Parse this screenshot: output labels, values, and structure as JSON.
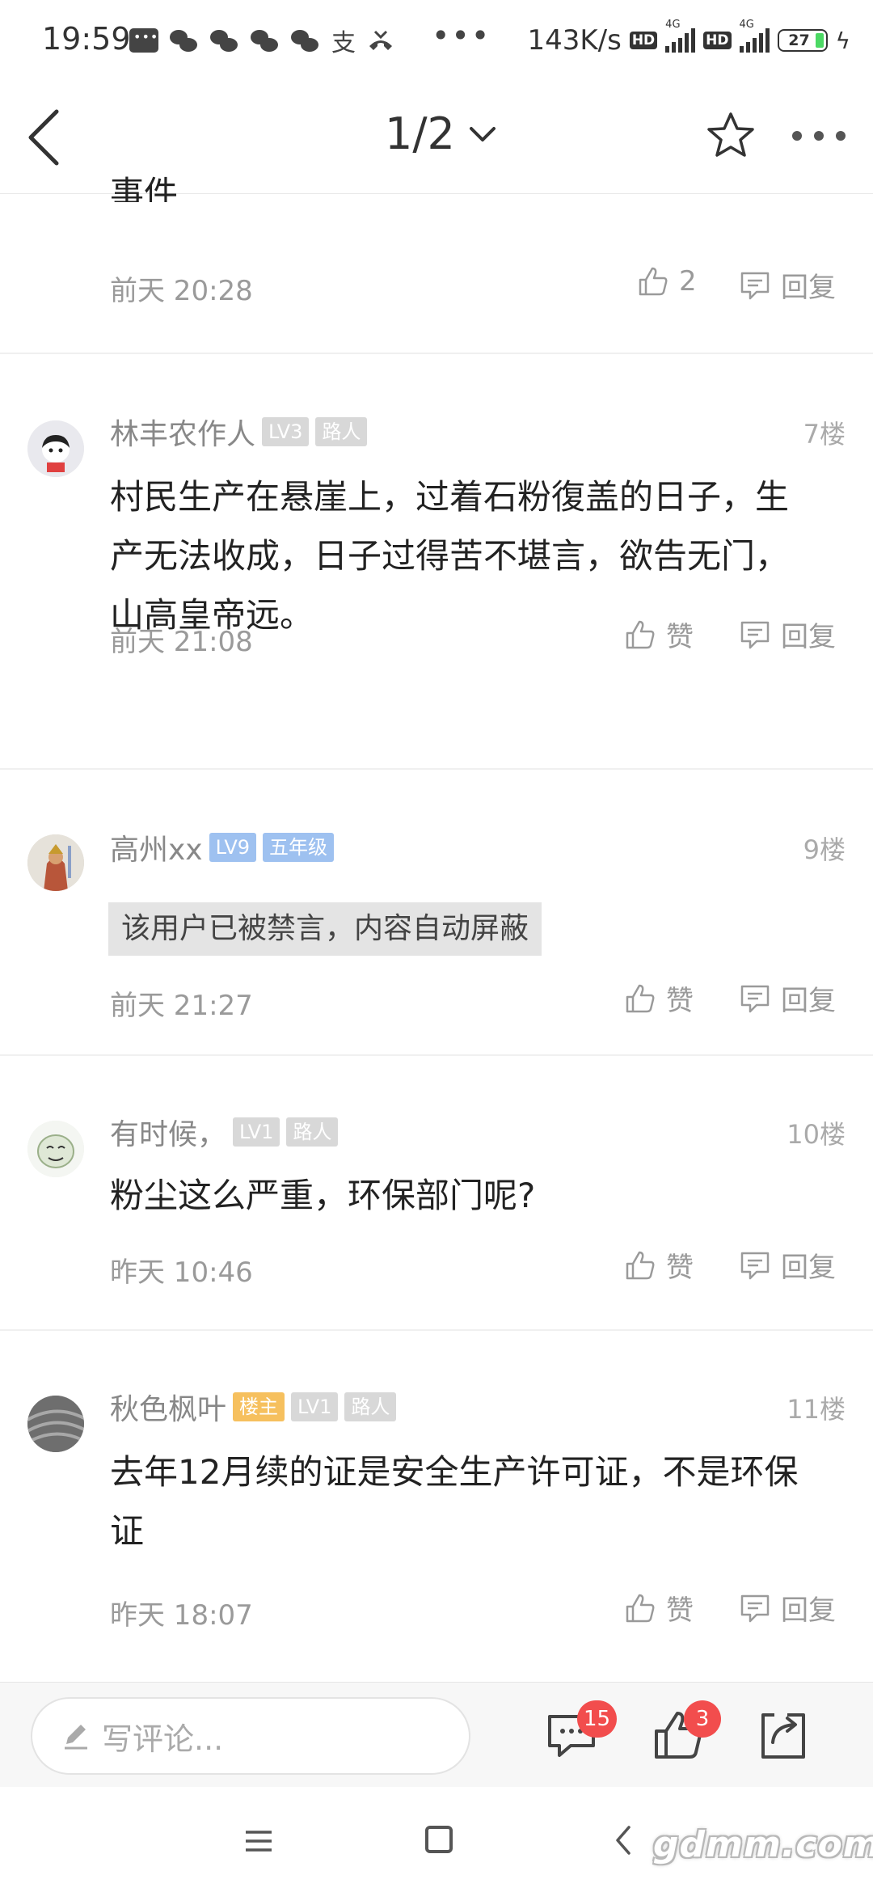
{
  "status_bar": {
    "time": "19:59",
    "speed": "143K/s",
    "hd": "HD",
    "network": "4G",
    "battery": "27",
    "dots": "•••",
    "alipay_glyph": "支",
    "bell_glyph": "⚡"
  },
  "nav": {
    "pager": "1/2"
  },
  "partial_comment": {
    "clipped_text": "事件",
    "time": "前天 20:28",
    "like_count": "2",
    "reply_label": "回复"
  },
  "comments": [
    {
      "username": "林丰农作人",
      "tags": [
        "LV3",
        "路人"
      ],
      "floor": "7楼",
      "text": "村民生产在悬崖上，过着石粉復盖的日子，生产无法收成，日子过得苦不堪言，欲告无门，山高皇帝远。",
      "time": "前天 21:08",
      "like_label": "赞",
      "reply_label": "回复"
    },
    {
      "username": "高州xx",
      "tags": [
        "LV9",
        "五年级"
      ],
      "floor": "9楼",
      "text": "该用户已被禁言，内容自动屏蔽",
      "time": "前天 21:27",
      "like_label": "赞",
      "reply_label": "回复"
    },
    {
      "username": "有时候，",
      "tags": [
        "LV1",
        "路人"
      ],
      "floor": "10楼",
      "text": "粉尘这么严重，环保部门呢?",
      "time": "昨天 10:46",
      "like_label": "赞",
      "reply_label": "回复"
    },
    {
      "username": "秋色枫叶",
      "tags": [
        "楼主",
        "LV1",
        "路人"
      ],
      "floor": "11楼",
      "text": "去年12月续的证是安全生产许可证，不是环保证",
      "time": "昨天 18:07",
      "like_label": "赞",
      "reply_label": "回复"
    }
  ],
  "bottom_bar": {
    "placeholder": "写评论...",
    "comment_badge": "15",
    "like_badge": "3"
  },
  "watermark": "gdmm.com",
  "colors": {
    "accent_badge": "#f24d4d",
    "tag_blue": "#9ec1f0",
    "tag_orange": "#f6c05e",
    "tag_gray": "#d8d8d8"
  }
}
